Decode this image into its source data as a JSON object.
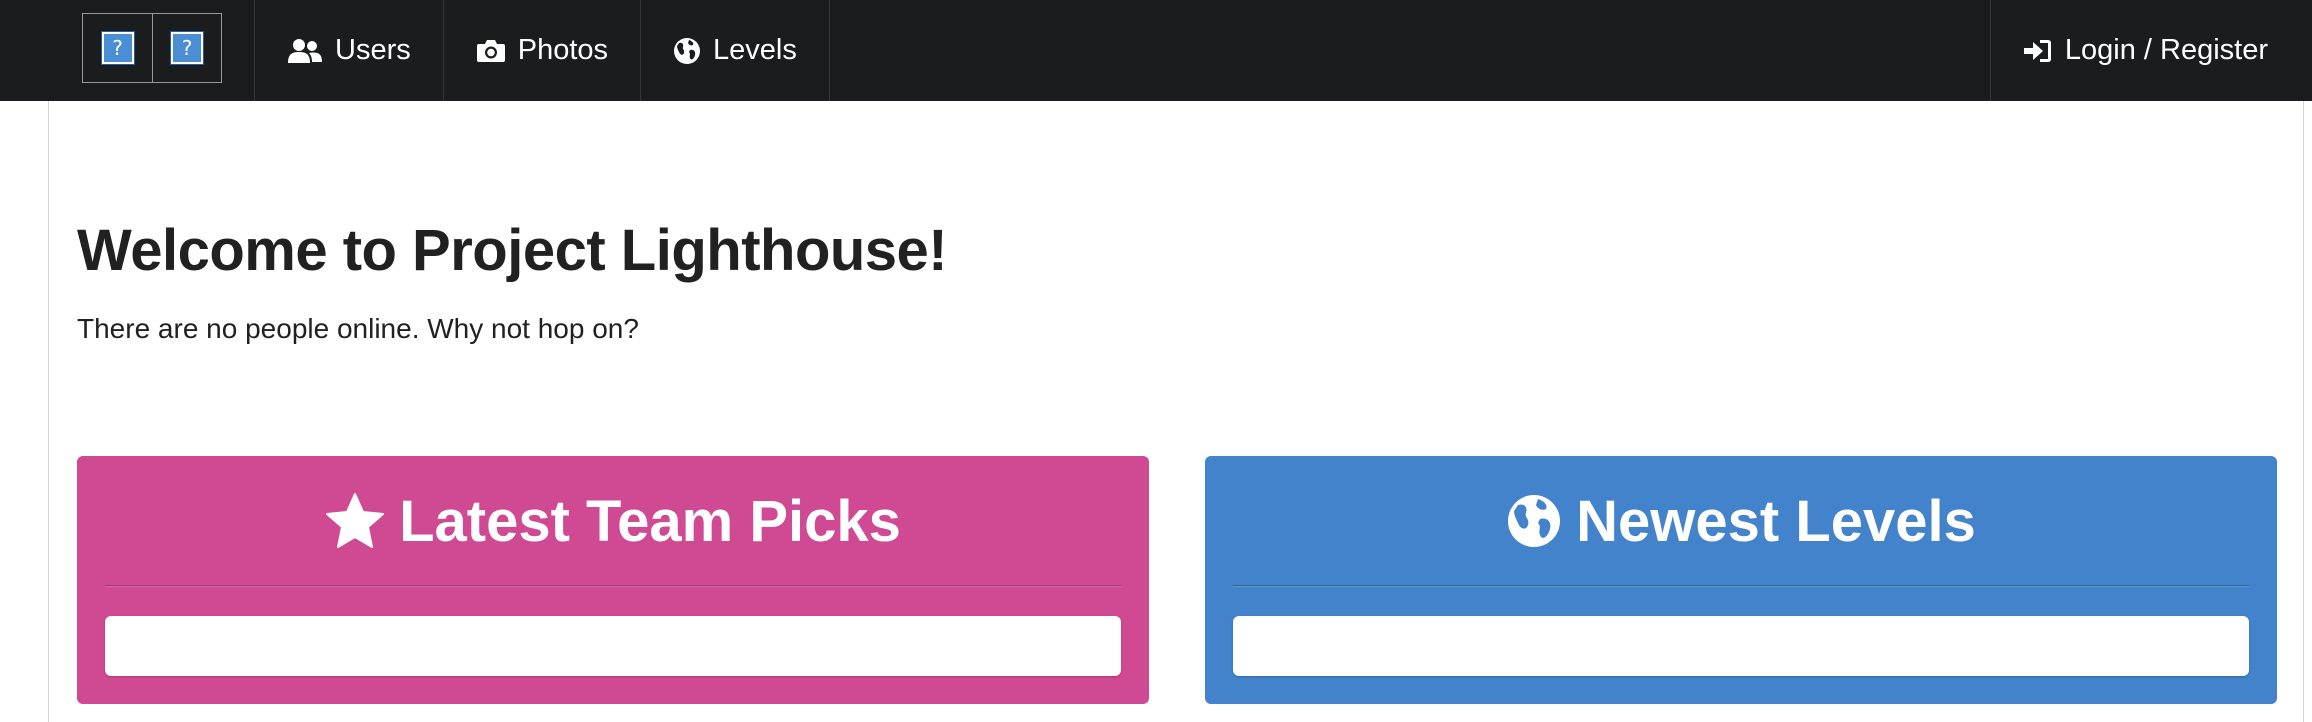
{
  "nav": {
    "image_placeholders": [
      "?",
      "?"
    ],
    "items": [
      {
        "label": "Users",
        "icon": "users-icon"
      },
      {
        "label": "Photos",
        "icon": "camera-icon"
      },
      {
        "label": "Levels",
        "icon": "globe-icon"
      }
    ],
    "login_label": "Login / Register",
    "login_icon": "sign-in-icon"
  },
  "main": {
    "title": "Welcome to Project Lighthouse!",
    "online_text": "There are no people online. Why not hop on?"
  },
  "panels": [
    {
      "title": "Latest Team Picks",
      "icon": "star-icon",
      "color": "#cf4a92"
    },
    {
      "title": "Newest Levels",
      "icon": "globe-icon",
      "color": "#4283cb"
    }
  ],
  "colors": {
    "navbar": "#1b1c1d",
    "placeholder_blue": "#4a8fd4"
  }
}
